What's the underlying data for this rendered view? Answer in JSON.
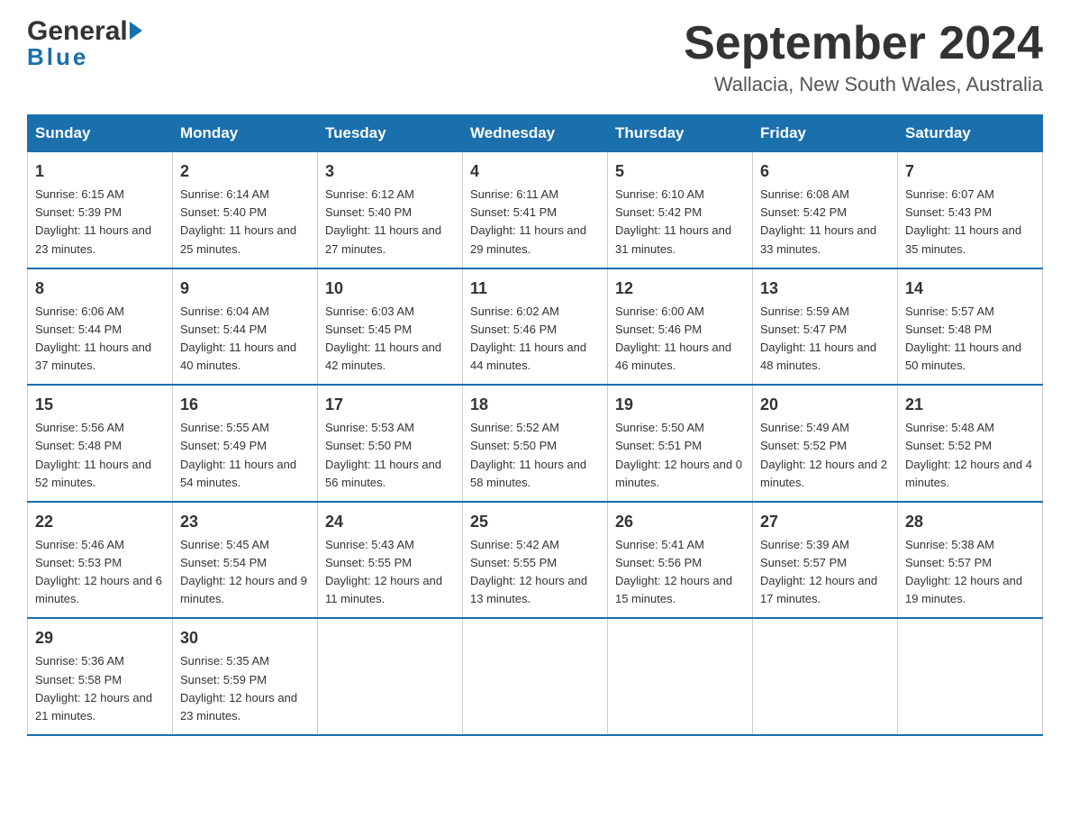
{
  "header": {
    "logo_general": "General",
    "logo_blue": "Blue",
    "month_title": "September 2024",
    "location": "Wallacia, New South Wales, Australia"
  },
  "calendar": {
    "days_of_week": [
      "Sunday",
      "Monday",
      "Tuesday",
      "Wednesday",
      "Thursday",
      "Friday",
      "Saturday"
    ],
    "weeks": [
      [
        {
          "day": "1",
          "sunrise": "6:15 AM",
          "sunset": "5:39 PM",
          "daylight": "11 hours and 23 minutes."
        },
        {
          "day": "2",
          "sunrise": "6:14 AM",
          "sunset": "5:40 PM",
          "daylight": "11 hours and 25 minutes."
        },
        {
          "day": "3",
          "sunrise": "6:12 AM",
          "sunset": "5:40 PM",
          "daylight": "11 hours and 27 minutes."
        },
        {
          "day": "4",
          "sunrise": "6:11 AM",
          "sunset": "5:41 PM",
          "daylight": "11 hours and 29 minutes."
        },
        {
          "day": "5",
          "sunrise": "6:10 AM",
          "sunset": "5:42 PM",
          "daylight": "11 hours and 31 minutes."
        },
        {
          "day": "6",
          "sunrise": "6:08 AM",
          "sunset": "5:42 PM",
          "daylight": "11 hours and 33 minutes."
        },
        {
          "day": "7",
          "sunrise": "6:07 AM",
          "sunset": "5:43 PM",
          "daylight": "11 hours and 35 minutes."
        }
      ],
      [
        {
          "day": "8",
          "sunrise": "6:06 AM",
          "sunset": "5:44 PM",
          "daylight": "11 hours and 37 minutes."
        },
        {
          "day": "9",
          "sunrise": "6:04 AM",
          "sunset": "5:44 PM",
          "daylight": "11 hours and 40 minutes."
        },
        {
          "day": "10",
          "sunrise": "6:03 AM",
          "sunset": "5:45 PM",
          "daylight": "11 hours and 42 minutes."
        },
        {
          "day": "11",
          "sunrise": "6:02 AM",
          "sunset": "5:46 PM",
          "daylight": "11 hours and 44 minutes."
        },
        {
          "day": "12",
          "sunrise": "6:00 AM",
          "sunset": "5:46 PM",
          "daylight": "11 hours and 46 minutes."
        },
        {
          "day": "13",
          "sunrise": "5:59 AM",
          "sunset": "5:47 PM",
          "daylight": "11 hours and 48 minutes."
        },
        {
          "day": "14",
          "sunrise": "5:57 AM",
          "sunset": "5:48 PM",
          "daylight": "11 hours and 50 minutes."
        }
      ],
      [
        {
          "day": "15",
          "sunrise": "5:56 AM",
          "sunset": "5:48 PM",
          "daylight": "11 hours and 52 minutes."
        },
        {
          "day": "16",
          "sunrise": "5:55 AM",
          "sunset": "5:49 PM",
          "daylight": "11 hours and 54 minutes."
        },
        {
          "day": "17",
          "sunrise": "5:53 AM",
          "sunset": "5:50 PM",
          "daylight": "11 hours and 56 minutes."
        },
        {
          "day": "18",
          "sunrise": "5:52 AM",
          "sunset": "5:50 PM",
          "daylight": "11 hours and 58 minutes."
        },
        {
          "day": "19",
          "sunrise": "5:50 AM",
          "sunset": "5:51 PM",
          "daylight": "12 hours and 0 minutes."
        },
        {
          "day": "20",
          "sunrise": "5:49 AM",
          "sunset": "5:52 PM",
          "daylight": "12 hours and 2 minutes."
        },
        {
          "day": "21",
          "sunrise": "5:48 AM",
          "sunset": "5:52 PM",
          "daylight": "12 hours and 4 minutes."
        }
      ],
      [
        {
          "day": "22",
          "sunrise": "5:46 AM",
          "sunset": "5:53 PM",
          "daylight": "12 hours and 6 minutes."
        },
        {
          "day": "23",
          "sunrise": "5:45 AM",
          "sunset": "5:54 PM",
          "daylight": "12 hours and 9 minutes."
        },
        {
          "day": "24",
          "sunrise": "5:43 AM",
          "sunset": "5:55 PM",
          "daylight": "12 hours and 11 minutes."
        },
        {
          "day": "25",
          "sunrise": "5:42 AM",
          "sunset": "5:55 PM",
          "daylight": "12 hours and 13 minutes."
        },
        {
          "day": "26",
          "sunrise": "5:41 AM",
          "sunset": "5:56 PM",
          "daylight": "12 hours and 15 minutes."
        },
        {
          "day": "27",
          "sunrise": "5:39 AM",
          "sunset": "5:57 PM",
          "daylight": "12 hours and 17 minutes."
        },
        {
          "day": "28",
          "sunrise": "5:38 AM",
          "sunset": "5:57 PM",
          "daylight": "12 hours and 19 minutes."
        }
      ],
      [
        {
          "day": "29",
          "sunrise": "5:36 AM",
          "sunset": "5:58 PM",
          "daylight": "12 hours and 21 minutes."
        },
        {
          "day": "30",
          "sunrise": "5:35 AM",
          "sunset": "5:59 PM",
          "daylight": "12 hours and 23 minutes."
        },
        null,
        null,
        null,
        null,
        null
      ]
    ]
  },
  "labels": {
    "sunrise": "Sunrise:",
    "sunset": "Sunset:",
    "daylight": "Daylight:"
  }
}
